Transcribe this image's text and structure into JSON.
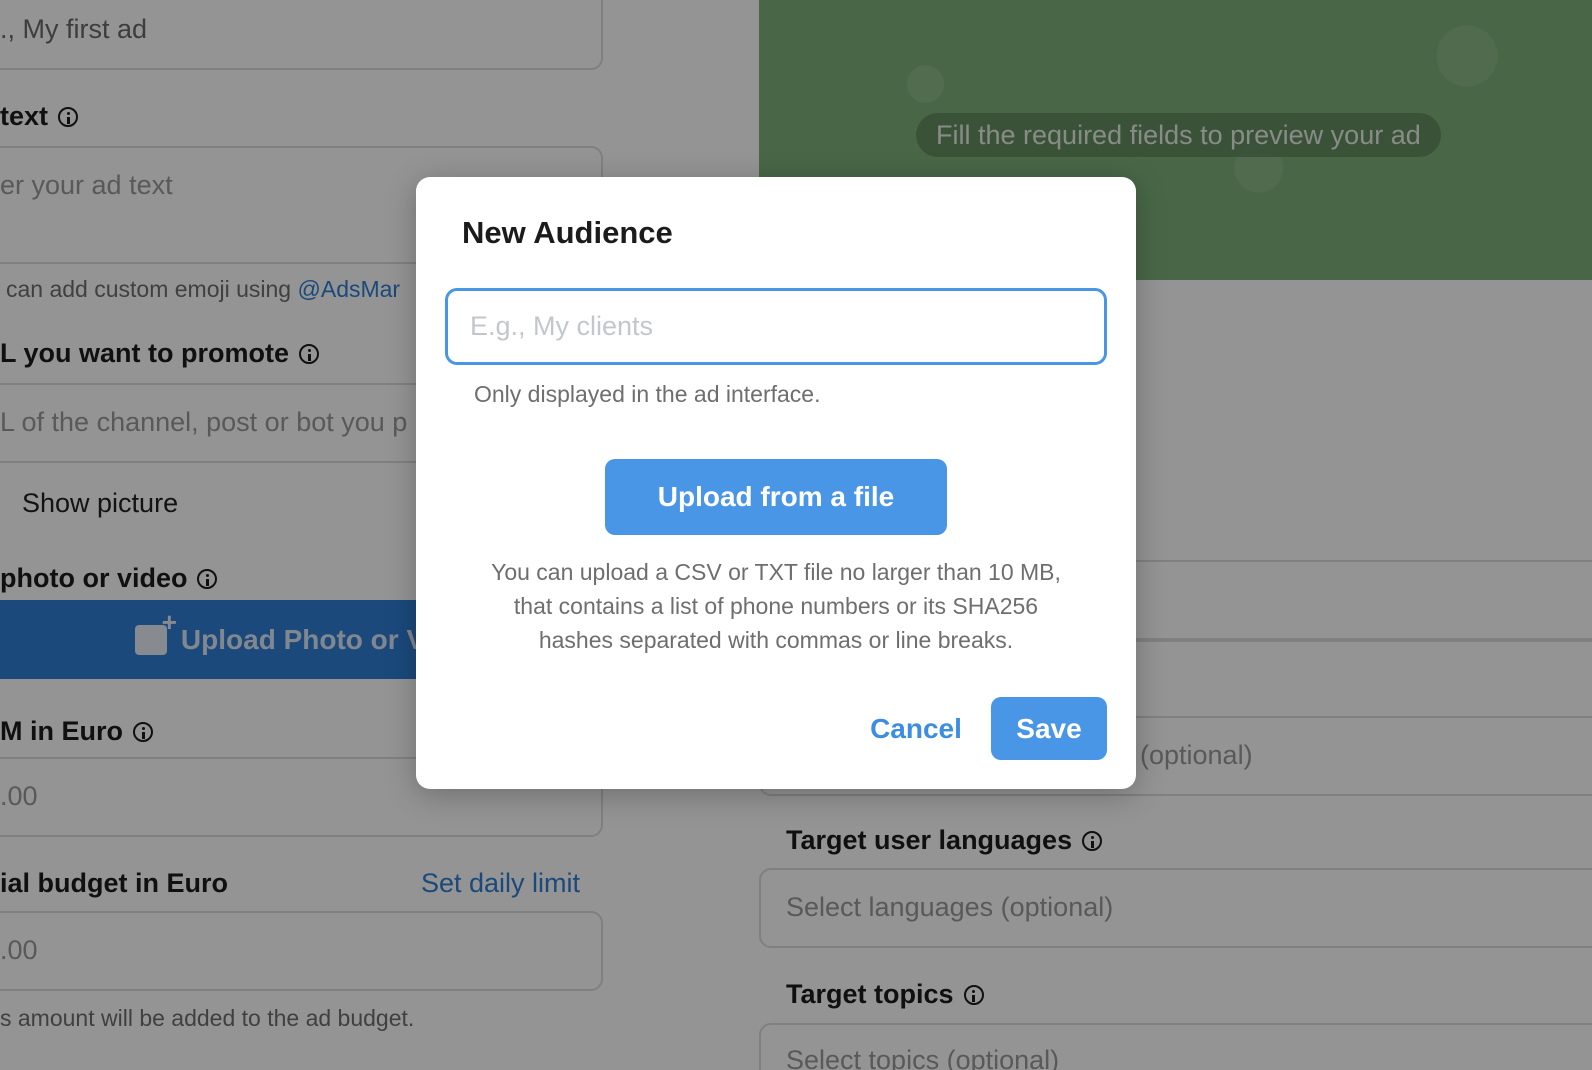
{
  "left_form": {
    "ad_title_value": "., My first ad",
    "ad_text_label": "text",
    "ad_text_placeholder": "er your ad text",
    "emoji_hint_prefix": "can add custom emoji using ",
    "emoji_hint_link": "@AdsMar",
    "url_label": "L you want to promote",
    "url_placeholder": "L of the channel, post or bot you p",
    "show_picture_label": "Show picture",
    "media_label": "photo or video",
    "upload_media_label": "Upload Photo or Vide",
    "cpm_label": "M in Euro",
    "cpm_value": ".00",
    "budget_label": "ial budget in Euro",
    "set_daily_limit": "Set daily limit",
    "budget_value": ".00",
    "budget_hint": "s amount will be added to the ad budget."
  },
  "preview": {
    "placeholder": "Fill the required fields to preview your ad"
  },
  "right_form": {
    "optional_placeholder": "(optional)",
    "languages_label": "Target user languages",
    "languages_placeholder": "Select languages (optional)",
    "topics_label": "Target topics",
    "topics_placeholder": "Select topics (optional)"
  },
  "modal": {
    "title": "New Audience",
    "name_placeholder": "E.g., My clients",
    "name_hint": "Only displayed in the ad interface.",
    "upload_label": "Upload from a file",
    "upload_description": "You can upload a CSV or TXT file no larger than 10 MB, that contains a list of phone numbers or its SHA256 hashes separated with commas or line breaks.",
    "cancel_label": "Cancel",
    "save_label": "Save"
  },
  "colors": {
    "accent": "#4a96e6",
    "link": "#2f7fd6",
    "preview_bg": "#7fb17a"
  }
}
